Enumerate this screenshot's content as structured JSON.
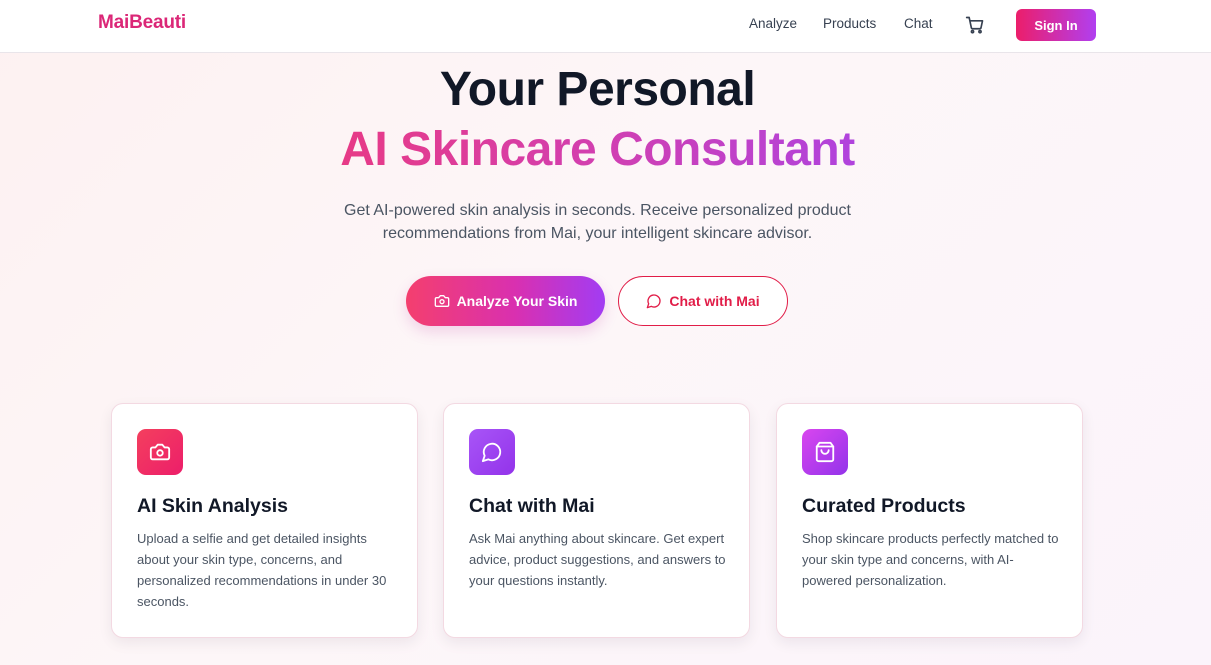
{
  "brand": "MaiBeauti",
  "nav": {
    "links": [
      "Analyze",
      "Products",
      "Chat"
    ],
    "cart_icon": "shopping-cart-icon",
    "signin_label": "Sign In"
  },
  "hero": {
    "title_line1": "Your Personal",
    "title_line2": "AI Skincare Consultant",
    "subtitle_line1": "Get AI-powered skin analysis in seconds. Receive personalized product",
    "subtitle_line2": "recommendations from Mai, your intelligent skincare advisor.",
    "primary_button": {
      "label": "Analyze Your Skin",
      "icon": "camera-icon"
    },
    "secondary_button": {
      "label": "Chat with Mai",
      "icon": "chat-bubble-icon"
    }
  },
  "features": [
    {
      "icon": "camera-icon",
      "title": "AI Skin Analysis",
      "description": "Upload a selfie and get detailed insights about your skin type, concerns, and personalized recommendations in under 30 seconds."
    },
    {
      "icon": "chat-bubble-icon",
      "title": "Chat with Mai",
      "description": "Ask Mai anything about skincare. Get expert advice, product suggestions, and answers to your questions instantly."
    },
    {
      "icon": "shopping-bag-icon",
      "title": "Curated Products",
      "description": "Shop skincare products perfectly matched to your skin type and concerns, with AI-powered personalization."
    }
  ],
  "colors": {
    "brand": "#db2777",
    "accent_pink": "#ec1e6a",
    "accent_purple": "#a23cf3",
    "outline_red": "#e11d48"
  }
}
